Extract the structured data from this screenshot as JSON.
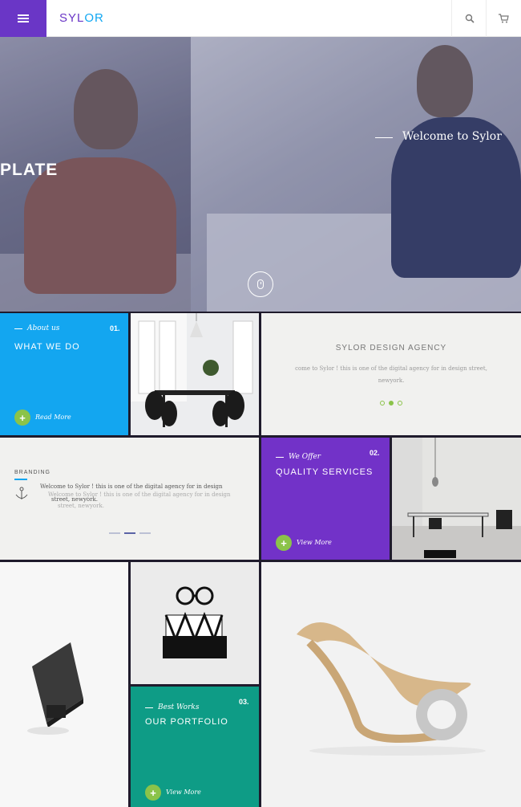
{
  "header": {
    "logo_prefix": "SYL",
    "logo_accent": "OR",
    "menu_icon": "hamburger-icon",
    "search_icon": "search-icon",
    "cart_icon": "cart-icon",
    "brand_color": "#6a36c6",
    "accent_color": "#10a7f2"
  },
  "hero": {
    "left_title": "PLATE",
    "welcome": "Welcome to Sylor",
    "scroll_icon": "mouse-icon"
  },
  "about": {
    "number": "01.",
    "subtitle": "About us",
    "title": "WHAT WE DO",
    "link": "Read More",
    "color": "#13a6f0"
  },
  "agency": {
    "title": "SYLOR DESIGN AGENCY",
    "text_line1": "come to Sylor ! this is one of the digital agency for in design street,",
    "text_line2": "newyork.",
    "slide_count": 3,
    "active_slide": 2
  },
  "branding": {
    "label": "BRANDING",
    "text_line1": "Welcome to Sylor ! this is one of the digital agency for in design",
    "text_line2": "street, newyork.",
    "ghost_line1": "Welcome to Sylor ! this is one of the digital agency for in design",
    "ghost_line2": "street, newyork.",
    "active_slide": 2
  },
  "services": {
    "number": "02.",
    "subtitle": "We Offer",
    "title": "QUALITY SERVICES",
    "link": "View More",
    "color": "#7232c8"
  },
  "portfolio": {
    "number": "03.",
    "subtitle": "Best Works",
    "title": "OUR PORTFOLIO",
    "link": "View More",
    "color": "#0e9c86"
  },
  "plus_symbol": "+"
}
